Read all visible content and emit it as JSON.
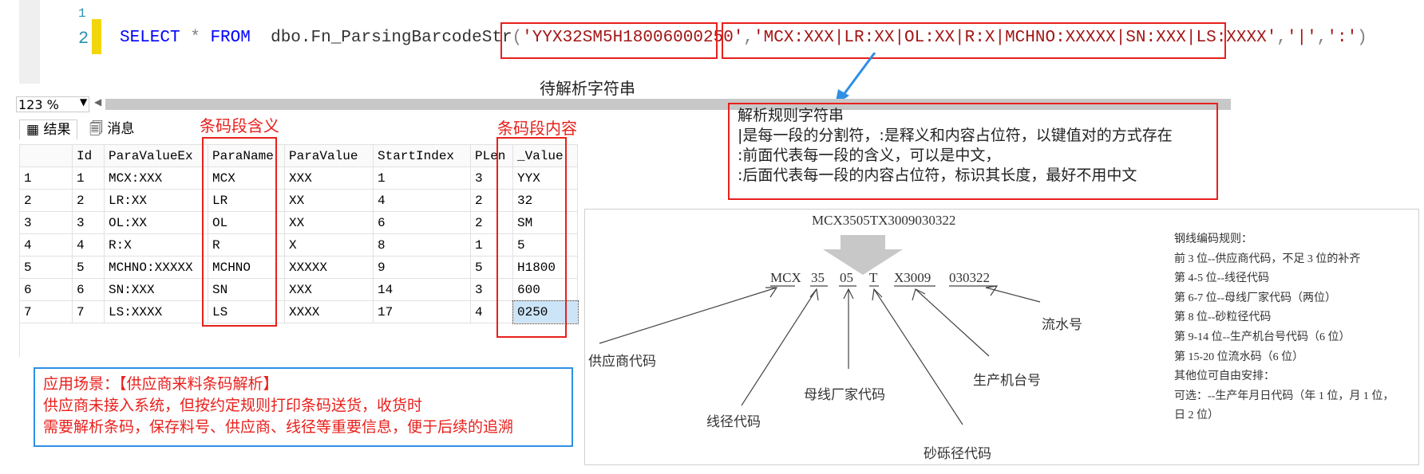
{
  "editor": {
    "line_numbers": [
      "1",
      "2"
    ],
    "sql": {
      "select": "SELECT",
      "star": "*",
      "from": "FROM",
      "func": "dbo.Fn_ParsingBarcodeStr",
      "open_paren": "(",
      "arg1": "'YYX32SM5H18006000250'",
      "comma1": ",",
      "arg2": "'MCX:XXX|LR:XX|OL:XX|R:X|MCHNO:XXXXX|SN:XXX|LS:XXXX'",
      "comma2": ",",
      "arg3": "'|'",
      "comma3": ",",
      "arg4": "':'",
      "close_paren": ")"
    }
  },
  "labels": {
    "string_to_parse": "待解析字符串",
    "segment_meaning": "条码段含义",
    "segment_content": "条码段内容"
  },
  "zoom": {
    "value": "123 %"
  },
  "tabs": [
    {
      "label": "结果",
      "icon": "grid-icon"
    },
    {
      "label": "消息",
      "icon": "message-icon"
    }
  ],
  "grid": {
    "columns": [
      "",
      "Id",
      "ParaValueEx",
      "ParaName",
      "ParaValue",
      "StartIndex",
      "PLen",
      "_Value"
    ],
    "rows": [
      [
        "1",
        "1",
        "MCX:XXX",
        "MCX",
        "XXX",
        "1",
        "3",
        "YYX"
      ],
      [
        "2",
        "2",
        "LR:XX",
        "LR",
        "XX",
        "4",
        "2",
        "32"
      ],
      [
        "3",
        "3",
        "OL:XX",
        "OL",
        "XX",
        "6",
        "2",
        "SM"
      ],
      [
        "4",
        "4",
        "R:X",
        "R",
        "X",
        "8",
        "1",
        "5"
      ],
      [
        "5",
        "5",
        "MCHNO:XXXXX",
        "MCHNO",
        "XXXXX",
        "9",
        "5",
        "H1800"
      ],
      [
        "6",
        "6",
        "SN:XXX",
        "SN",
        "XXX",
        "14",
        "3",
        "600"
      ],
      [
        "7",
        "7",
        "LS:XXXX",
        "LS",
        "XXXX",
        "17",
        "4",
        "0250"
      ]
    ]
  },
  "rule_callout": {
    "lines": [
      "解析规则字符串",
      "|是每一段的分割符，:是释义和内容占位符，以键值对的方式存在",
      ":前面代表每一段的含义，可以是中文，",
      ":后面代表每一段的内容占位符，标识其长度，最好不用中文"
    ]
  },
  "scenario": {
    "lines": [
      "应用场景：【供应商来料条码解析】",
      "供应商未接入系统，但按约定规则打印条码送货，收货时",
      "需要解析条码，保存料号、供应商、线径等重要信息，便于后续的追溯"
    ]
  },
  "diagram": {
    "barcode": "MCX3505TX3009030322",
    "segments": [
      "MCX",
      "35",
      "05",
      "T",
      "X3009",
      "030322"
    ],
    "captions": {
      "supplier": "供应商代码",
      "wire_diameter": "线径代码",
      "busbar_maker": "母线厂家代码",
      "gravel_diameter": "砂砾径代码",
      "machine": "生产机台号",
      "serial": "流水号"
    },
    "rules": [
      "钢线编码规则：",
      "前 3 位--供应商代码，不足 3 位的补齐",
      "第 4-5 位--线径代码",
      "第 6-7 位--母线厂家代码（两位）",
      "第 8 位--砂粒径代码",
      "第 9-14 位--生产机台号代码（6 位）",
      "第 15-20 位流水码（6 位）",
      "其他位可自由安排：",
      "可选：--生产年月日代码（年 1 位，月 1 位，",
      "日 2 位）"
    ]
  },
  "colors": {
    "annotation_red": "#e8201c",
    "annotation_blue": "#2e8fe6",
    "selection": "#cce4f7"
  }
}
